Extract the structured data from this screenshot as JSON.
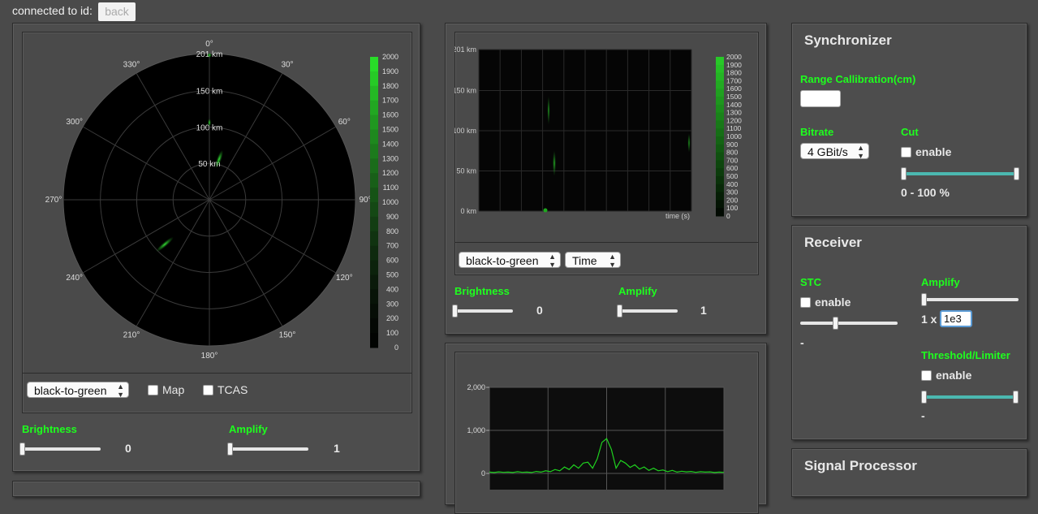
{
  "header": {
    "connected_label": "connected to id:",
    "back_button": "back"
  },
  "radar": {
    "bearings": [
      {
        "deg": 0,
        "label": "0°"
      },
      {
        "deg": 30,
        "label": "30°"
      },
      {
        "deg": 60,
        "label": "60°"
      },
      {
        "deg": 90,
        "label": "90°"
      },
      {
        "deg": 120,
        "label": "120°"
      },
      {
        "deg": 150,
        "label": "150°"
      },
      {
        "deg": 180,
        "label": "180°"
      },
      {
        "deg": 210,
        "label": "210°"
      },
      {
        "deg": 240,
        "label": "240°"
      },
      {
        "deg": 270,
        "label": "270°"
      },
      {
        "deg": 300,
        "label": "300°"
      },
      {
        "deg": 330,
        "label": "330°"
      }
    ],
    "range_labels": [
      {
        "km": 50,
        "label": "50 km"
      },
      {
        "km": 100,
        "label": "100 km"
      },
      {
        "km": 150,
        "label": "150 km"
      },
      {
        "km": 201,
        "label": "201 km"
      }
    ],
    "max_range_km": 201,
    "colorbar_ticks": [
      "2000",
      "1900",
      "1800",
      "1700",
      "1600",
      "1500",
      "1400",
      "1300",
      "1200",
      "1100",
      "1000",
      "900",
      "800",
      "700",
      "600",
      "500",
      "400",
      "300",
      "200",
      "100",
      "0"
    ],
    "colormap_select": "black-to-green",
    "map_checkbox": "Map",
    "tcas_checkbox": "TCAS",
    "brightness_label": "Brightness",
    "brightness_value": "0",
    "brightness_level": 0,
    "amplify_label": "Amplify",
    "amplify_value": "1",
    "amplify_level": 0
  },
  "waterfall": {
    "y_labels": [
      {
        "km": 201,
        "label": "201 km"
      },
      {
        "km": 150,
        "label": "150 km"
      },
      {
        "km": 100,
        "label": "100 km"
      },
      {
        "km": 50,
        "label": "50 km"
      },
      {
        "km": 0,
        "label": "0 km"
      }
    ],
    "x_axis_label": "time (s)",
    "colorbar_ticks": [
      "2000",
      "1900",
      "1800",
      "1700",
      "1600",
      "1500",
      "1400",
      "1300",
      "1200",
      "1100",
      "1000",
      "900",
      "800",
      "700",
      "600",
      "500",
      "400",
      "300",
      "200",
      "100",
      "0"
    ],
    "colormap_select": "black-to-green",
    "axis_select": "Time",
    "brightness_label": "Brightness",
    "brightness_value": "0",
    "brightness_level": 0,
    "amplify_label": "Amplify",
    "amplify_value": "1",
    "amplify_level": 0
  },
  "chart_data": {
    "type": "line",
    "ytick_labels": [
      "2,000",
      "1,000",
      "0"
    ],
    "yticks": [
      2000,
      1000,
      0
    ],
    "ylim": [
      0,
      2000
    ],
    "x": [
      0,
      2,
      4,
      6,
      8,
      10,
      12,
      14,
      16,
      18,
      20,
      22,
      24,
      26,
      28,
      30,
      32,
      34,
      36,
      38,
      40,
      42,
      44,
      46,
      48,
      50,
      52,
      54,
      56,
      58,
      60,
      62,
      64,
      66,
      68,
      70,
      72,
      74,
      76,
      78,
      80,
      82,
      84,
      86,
      88,
      90,
      92,
      94,
      96,
      98,
      100
    ],
    "values": [
      30,
      20,
      35,
      25,
      30,
      20,
      40,
      25,
      30,
      20,
      45,
      30,
      60,
      40,
      90,
      60,
      150,
      90,
      200,
      120,
      240,
      260,
      120,
      340,
      720,
      810,
      560,
      120,
      300,
      240,
      140,
      200,
      100,
      150,
      70,
      120,
      60,
      80,
      40,
      70,
      30,
      50,
      35,
      45,
      25,
      40,
      30,
      35,
      20,
      30,
      25
    ],
    "series_color": "#1fd11f",
    "grid": true
  },
  "synchronizer": {
    "title": "Synchronizer",
    "range_cal_label": "Range Callibration(cm)",
    "range_cal_value": "",
    "bitrate_label": "Bitrate",
    "bitrate_select": "4 GBit/s",
    "cut_label": "Cut",
    "cut_enable": "enable",
    "cut_range_text": "0 - 100 %",
    "cut_low": 0,
    "cut_high": 1
  },
  "receiver": {
    "title": "Receiver",
    "stc_label": "STC",
    "stc_enable": "enable",
    "stc_value": "-",
    "stc_level": 0.35,
    "amplify_label": "Amplify",
    "amplify_prefix": "1 x",
    "amplify_input": "1e3",
    "amplify_level": 0,
    "threshold_label": "Threshold/Limiter",
    "threshold_enable": "enable",
    "threshold_value": "-",
    "threshold_low": 0,
    "threshold_high": 1
  },
  "signal_processor": {
    "title": "Signal Processor"
  }
}
